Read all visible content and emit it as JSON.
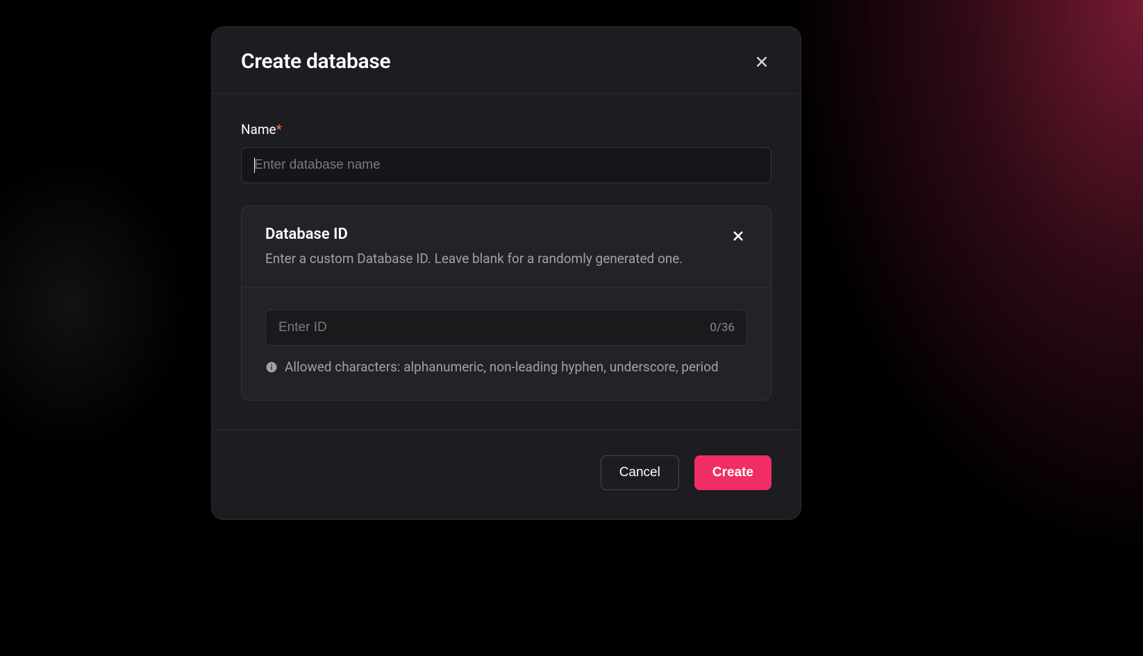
{
  "modal": {
    "title": "Create database",
    "name_field": {
      "label": "Name",
      "required_marker": "*",
      "placeholder": "Enter database name",
      "value": ""
    },
    "id_panel": {
      "title": "Database ID",
      "description": "Enter a custom Database ID. Leave blank for a randomly generated one.",
      "placeholder": "Enter ID",
      "value": "",
      "counter": "0/36",
      "hint": "Allowed characters: alphanumeric, non-leading hyphen, underscore, period"
    },
    "actions": {
      "cancel": "Cancel",
      "create": "Create"
    }
  }
}
